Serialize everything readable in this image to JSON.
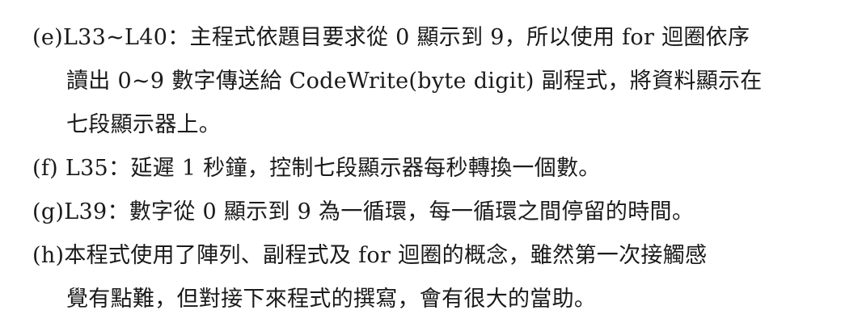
{
  "items": [
    {
      "marker": "(e)",
      "lines": [
        "L33~L40：主程式依題目要求從 0 顯示到 9，所以使用 for 迴圈依序",
        "讀出 0~9 數字傳送給 CodeWrite(byte digit) 副程式，將資料顯示在",
        "七段顯示器上。"
      ]
    },
    {
      "marker": "(f)",
      "lines": [
        " L35：延遲 1 秒鐘，控制七段顯示器每秒轉換一個數。"
      ]
    },
    {
      "marker": "(g)",
      "lines": [
        "L39：數字從 0 顯示到 9 為一循環，每一循環之間停留的時間。"
      ]
    },
    {
      "marker": "(h)",
      "lines": [
        "本程式使用了陣列、副程式及 for 迴圈的概念，雖然第一次接觸感",
        "覺有點難，但對接下來程式的撰寫，會有很大的當助。"
      ]
    }
  ]
}
